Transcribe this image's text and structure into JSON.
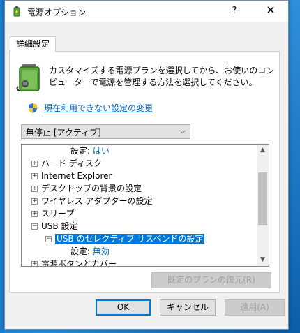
{
  "window": {
    "title": "電源オプション",
    "help_label": "?",
    "close_label": "✕"
  },
  "tab": {
    "label": "詳細設定"
  },
  "description": "カスタマイズする電源プランを選択してから、お使いのコンピューターで電源を管理する方法を選択してください。",
  "link": {
    "label": "現在利用できない設定の変更"
  },
  "plan_select": {
    "value": "無停止 [アクティブ]"
  },
  "tree": {
    "items": [
      {
        "label": "設定:",
        "value": "はい"
      },
      {
        "label": "ハード ディスク",
        "expander": "+"
      },
      {
        "label": "Internet Explorer",
        "expander": "+"
      },
      {
        "label": "デスクトップの背景の設定",
        "expander": "+"
      },
      {
        "label": "ワイヤレス アダプターの設定",
        "expander": "+"
      },
      {
        "label": "スリープ",
        "expander": "+"
      },
      {
        "label": "USB 設定",
        "expander": "−"
      },
      {
        "label": "USB のセレクティブ サスペンドの設定",
        "expander": "−",
        "selected": true
      },
      {
        "label": "設定:",
        "value": "無効"
      },
      {
        "label": "電源ボタンとカバー",
        "expander": "+"
      }
    ]
  },
  "buttons": {
    "restore": "既定のプランの復元(R)",
    "ok": "OK",
    "cancel": "キャンセル",
    "apply": "適用(A)"
  },
  "icons": {
    "title": "power-options-icon",
    "battery": "battery-plug-icon",
    "shield": "uac-shield-icon",
    "select_arrow": "chevron-down-icon"
  },
  "colors": {
    "link": "#0066cc",
    "selection": "#0078d7"
  }
}
